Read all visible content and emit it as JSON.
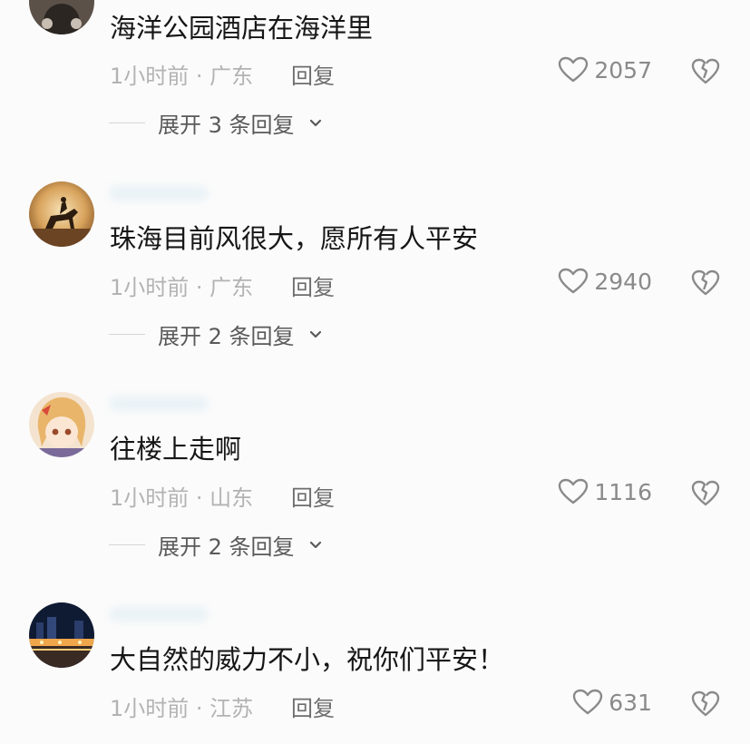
{
  "comments": [
    {
      "text": "海洋公园酒店在海洋里",
      "time": "1小时前",
      "location": "广东",
      "reply_label": "回复",
      "likes": "2057",
      "expand_label": "展开 3 条回复",
      "avatar": "avatar-dark"
    },
    {
      "text": "珠海目前风很大，愿所有人平安",
      "time": "1小时前",
      "location": "广东",
      "reply_label": "回复",
      "likes": "2940",
      "expand_label": "展开 2 条回复",
      "avatar": "avatar-horse-rider"
    },
    {
      "text": "往楼上走啊",
      "time": "1小时前",
      "location": "山东",
      "reply_label": "回复",
      "likes": "1116",
      "expand_label": "展开 2 条回复",
      "avatar": "avatar-anime-girl"
    },
    {
      "text": "大自然的威力不小，祝你们平安！",
      "time": "1小时前",
      "location": "江苏",
      "reply_label": "回复",
      "likes": "631",
      "avatar": "avatar-night-city"
    }
  ],
  "icons": {
    "like": "heart-outline-icon",
    "dislike": "broken-heart-icon",
    "expand": "chevron-down-icon"
  },
  "colors": {
    "text": "#161616",
    "meta": "#b3b3b3",
    "reply": "#6d6d6d",
    "icon": "#8a8a8a"
  }
}
